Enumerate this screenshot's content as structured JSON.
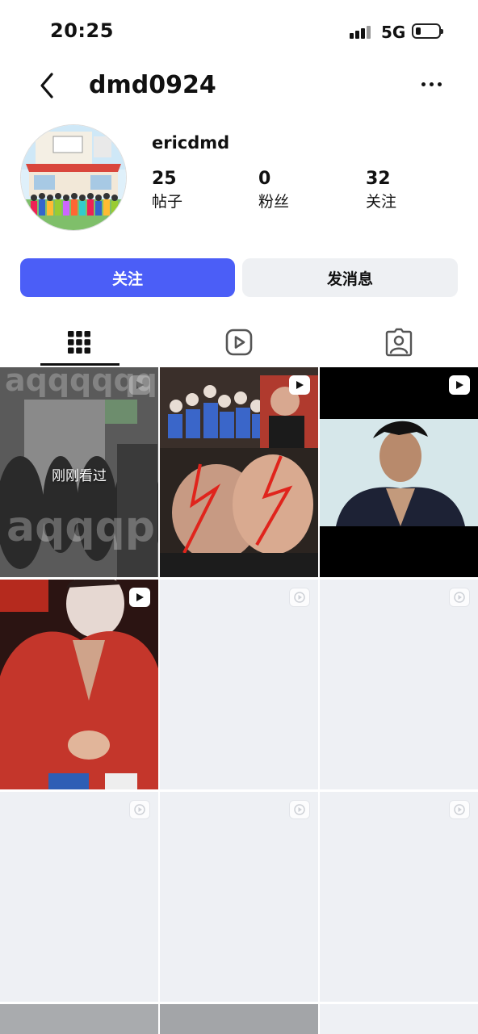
{
  "status_bar": {
    "time": "20:25",
    "network": "5G"
  },
  "header": {
    "username": "dmd0924"
  },
  "profile": {
    "display_name": "ericdmd",
    "stats": [
      {
        "count": "25",
        "label": "帖子"
      },
      {
        "count": "0",
        "label": "粉丝"
      },
      {
        "count": "32",
        "label": "关注"
      }
    ]
  },
  "actions": {
    "follow_label": "关注",
    "message_label": "发消息"
  },
  "tabs": [
    "grid-icon",
    "video-icon",
    "tagged-icon"
  ],
  "grid": {
    "recently_viewed_label": "刚刚看过",
    "watermark_text": "aqqqqqqqq",
    "watermark_text_2": "aqqqpp"
  },
  "colors": {
    "accent": "#4b5ef7",
    "secondary_button": "#eef0f3",
    "placeholder_tile": "#eef0f4"
  }
}
